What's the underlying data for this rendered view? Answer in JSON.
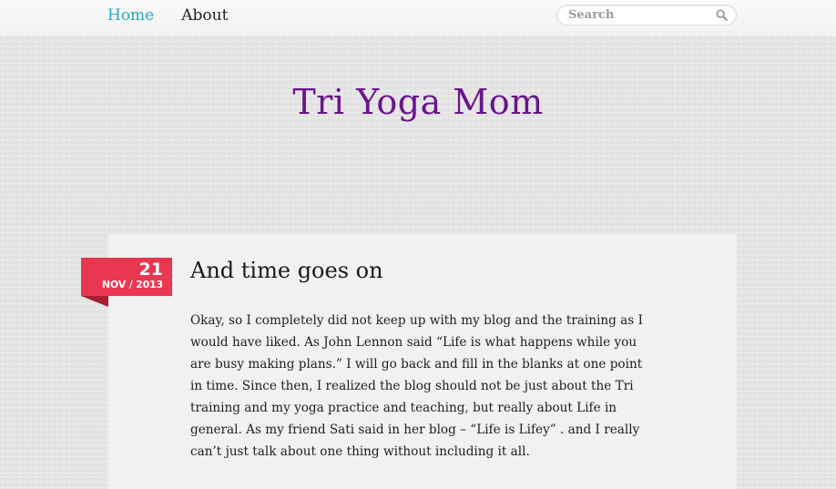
{
  "nav": {
    "items": [
      {
        "label": "Home",
        "active": true
      },
      {
        "label": "About",
        "active": false
      }
    ]
  },
  "search": {
    "placeholder": "Search",
    "value": "",
    "icon": "search-icon"
  },
  "site": {
    "title": "Tri Yoga Mom"
  },
  "post": {
    "date": {
      "day": "21",
      "month_year": "NOV / 2013"
    },
    "title": "And time goes on",
    "body": "Okay, so I completely did not keep up with my blog and the training as I would have liked. As John Lennon said “Life is what happens while you are busy making plans.”  I will go back and fill in the blanks at one point in time. Since then, I realized the blog should not be just about the Tri training  and my yoga practice and teaching, but really about Life in general. As my  friend Sati said in her blog – “Life is Lifey” . and I really can’t just talk about one thing without including it all."
  },
  "colors": {
    "nav_active": "#2aa7c0",
    "site_title": "#6a148e",
    "date_ribbon": "#e9374f",
    "card_background": "#f1f1f2"
  }
}
